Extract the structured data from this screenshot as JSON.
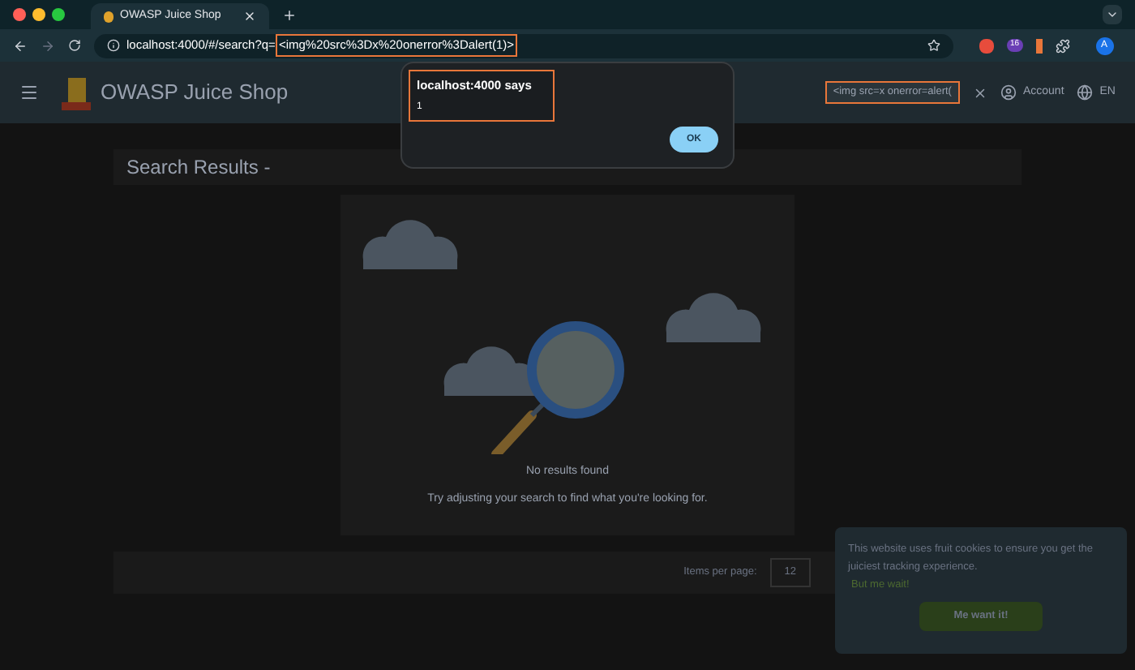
{
  "browser": {
    "tab_title": "OWASP Juice Shop",
    "url_base": "localhost:4000/#/search?q=",
    "url_query": "<img%20src%3Dx%20onerror%3Dalert(1)>",
    "extension_badge": "16",
    "profile_initial": "A"
  },
  "toolbar": {
    "title": "OWASP Juice Shop",
    "search_value": "<img src=x onerror=alert(",
    "account": "Account",
    "language": "EN"
  },
  "results": {
    "heading": "Search Results -",
    "empty_title": "No results found",
    "empty_message": "Try adjusting your search to find what you're looking for."
  },
  "paginator": {
    "label": "Items per page:",
    "value": "12"
  },
  "dialog": {
    "title": "localhost:4000 says",
    "message": "1",
    "button": "OK"
  },
  "cookie_banner": {
    "text": "This website uses fruit cookies to ensure you get the juiciest tracking experience.",
    "link": "But me wait!",
    "button": "Me want it!"
  }
}
